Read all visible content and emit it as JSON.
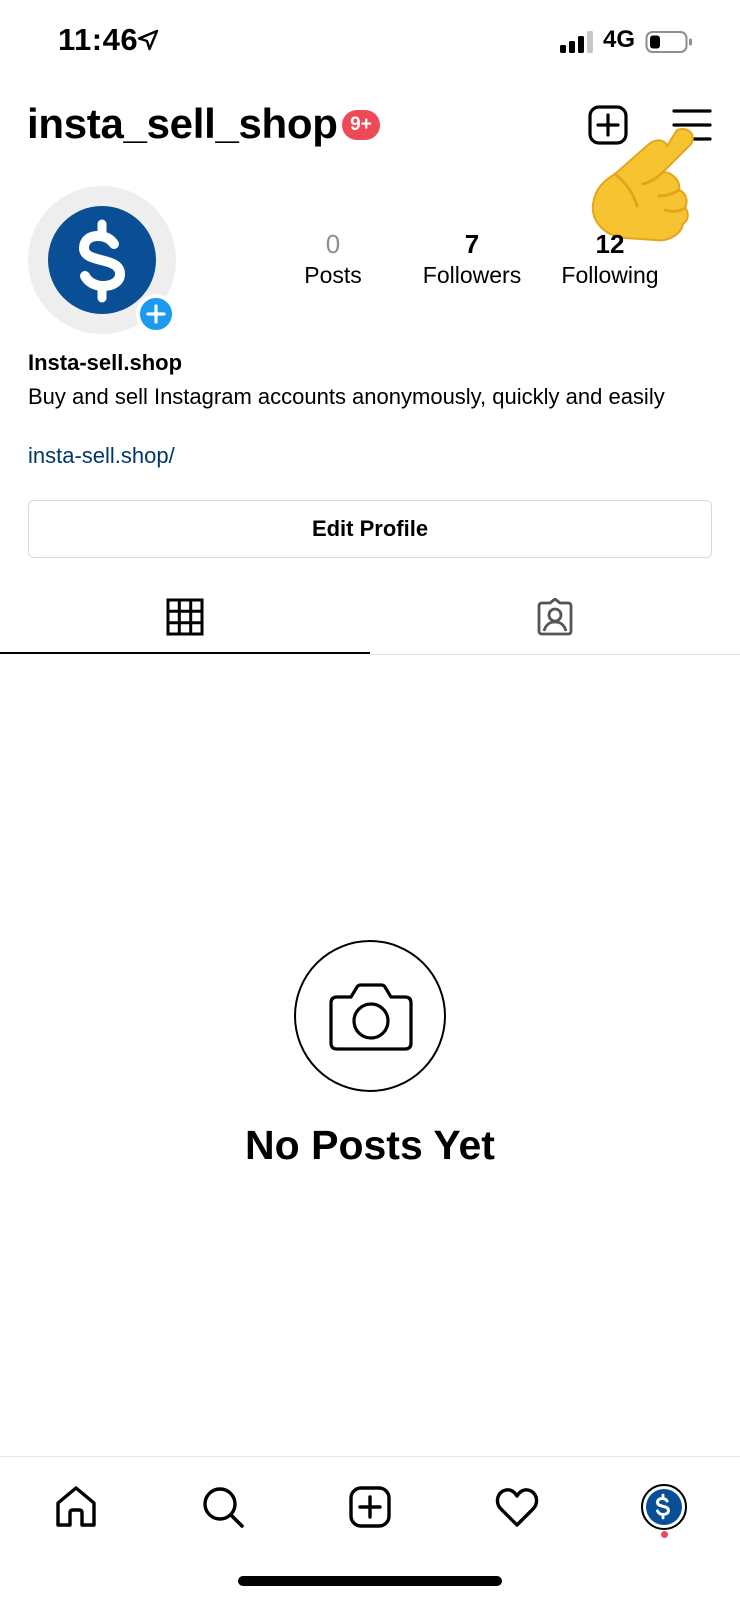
{
  "status_bar": {
    "time": "11:46",
    "network": "4G",
    "icons": [
      "location-arrow-icon",
      "signal-bars-icon",
      "battery-icon"
    ]
  },
  "header": {
    "username": "insta_sell_shop",
    "notification_badge": "9+",
    "icons": [
      "new-post-icon",
      "menu-icon"
    ]
  },
  "profile": {
    "display_name": "Insta-sell.shop",
    "bio": "Buy and sell Instagram accounts anonymously, quickly and easily",
    "link": "insta-sell.shop/",
    "stats": [
      {
        "value": "0",
        "label": "Posts"
      },
      {
        "value": "7",
        "label": "Followers"
      },
      {
        "value": "12",
        "label": "Following"
      }
    ],
    "edit_profile_label": "Edit Profile"
  },
  "tabs": [
    {
      "icon": "grid-icon",
      "active": true
    },
    {
      "icon": "tagged-icon",
      "active": false
    }
  ],
  "empty_state": {
    "title": "No Posts Yet",
    "icon": "camera-icon"
  },
  "bottom_nav": [
    {
      "icon": "home-icon"
    },
    {
      "icon": "search-icon"
    },
    {
      "icon": "add-icon"
    },
    {
      "icon": "heart-icon"
    },
    {
      "icon": "profile-avatar-icon"
    }
  ],
  "colors": {
    "badge": "#ed4956",
    "avatar_bg": "#0a4f96",
    "add_button": "#1a9bf0",
    "link": "#00376b"
  }
}
